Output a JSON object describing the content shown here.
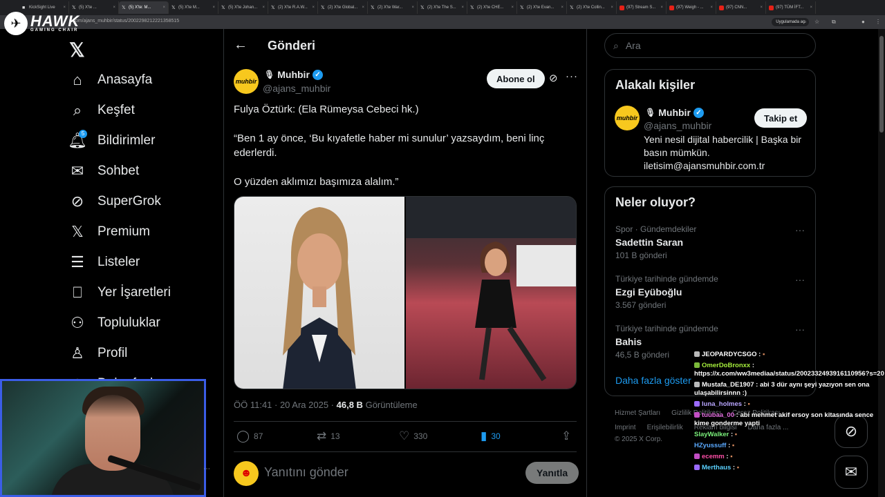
{
  "browser": {
    "tabs": [
      {
        "label": "KickSight Live",
        "icon": "k"
      },
      {
        "label": "(5) X'te ...",
        "icon": "x"
      },
      {
        "label": "(5) X'te: M...",
        "icon": "x",
        "active": true
      },
      {
        "label": "(5) X'te M...",
        "icon": "x"
      },
      {
        "label": "(5) X'te Johan...",
        "icon": "x"
      },
      {
        "label": "(2) X'te R.A.W...",
        "icon": "x"
      },
      {
        "label": "(2) X'te Global...",
        "icon": "x"
      },
      {
        "label": "(2) X'te War...",
        "icon": "x"
      },
      {
        "label": "(2) X'te The S...",
        "icon": "x"
      },
      {
        "label": "(2) X'te CHE...",
        "icon": "x"
      },
      {
        "label": "(2) X'te Evan...",
        "icon": "x"
      },
      {
        "label": "(2) X'te Collin...",
        "icon": "x"
      },
      {
        "label": "(97) Stream S...",
        "icon": "yt"
      },
      {
        "label": "(97) Weigh - ...",
        "icon": "yt"
      },
      {
        "label": "(97) CNN...",
        "icon": "yt"
      },
      {
        "label": "(97) TÜM İFT...",
        "icon": "yt"
      }
    ],
    "url": "x.com/ajans_muhbir/status/2002298212221358515",
    "open_in_app": "Uygulamada aç"
  },
  "overlay_logo": {
    "name": "HAWK",
    "sub": "GAMING CHAIR"
  },
  "nav": {
    "items": [
      {
        "key": "home",
        "label": "Anasayfa",
        "icon": "home-icon"
      },
      {
        "key": "explore",
        "label": "Keşfet",
        "icon": "search-icon"
      },
      {
        "key": "notifications",
        "label": "Bildirimler",
        "icon": "bell-icon",
        "badge": "5"
      },
      {
        "key": "chat",
        "label": "Sohbet",
        "icon": "mail-icon"
      },
      {
        "key": "supergrok",
        "label": "SuperGrok",
        "icon": "grok-icon"
      },
      {
        "key": "premium",
        "label": "Premium",
        "icon": "x-logo-icon"
      },
      {
        "key": "lists",
        "label": "Listeler",
        "icon": "list-icon"
      },
      {
        "key": "bookmarks",
        "label": "Yer İşaretleri",
        "icon": "bookmark-icon"
      },
      {
        "key": "communities",
        "label": "Topluluklar",
        "icon": "people-icon"
      },
      {
        "key": "profile",
        "label": "Profil",
        "icon": "person-icon"
      },
      {
        "key": "more",
        "label": "Daha fazla",
        "icon": "more-circle-icon"
      }
    ]
  },
  "post": {
    "header_title": "Gönderi",
    "author_name": "Muhbir",
    "author_handle": "@ajans_muhbir",
    "avatar_text": "muhbir",
    "subscribe_label": "Abone ol",
    "text_lines": [
      "Fulya Öztürk: (Ela Rümeysa Cebeci hk.)",
      "“Ben 1 ay önce, ‘Bu kıyafetle haber mi sunulur’ yazsaydım, beni linç ederlerdi.",
      "O yüzden aklımızı başımıza alalım.”"
    ],
    "timestamp": "ÖÖ 11:41 · 20 Ara 2025 ·",
    "views": "46,8 B",
    "views_label": "Görüntüleme",
    "replies": "87",
    "reposts": "13",
    "likes": "330",
    "bookmarks": "30",
    "reply_placeholder": "Yanıtını gönder",
    "reply_button": "Yanıtla"
  },
  "search": {
    "placeholder": "Ara"
  },
  "related": {
    "title": "Alakalı kişiler",
    "name": "Muhbir",
    "handle": "@ajans_muhbir",
    "follow_label": "Takip et",
    "bio": "Yeni nesil dijital habercilik | Başka bir basın mümkün. iletisim@ajansmuhbir.com.tr"
  },
  "trends": {
    "title": "Neler oluyor?",
    "items": [
      {
        "category": "Spor · Gündemdekiler",
        "name": "Sadettin Saran",
        "count": "101 B gönderi"
      },
      {
        "category": "Türkiye tarihinde gündemde",
        "name": "Ezgi Eyüboğlu",
        "count": "3.567 gönderi"
      },
      {
        "category": "Türkiye tarihinde gündemde",
        "name": "Bahis",
        "count": "46,5 B gönderi"
      }
    ],
    "show_more": "Daha fazla göster"
  },
  "footer": {
    "row1": [
      "Hizmet Şartları",
      "Gizlilik Politikası",
      "Çerez Politikası"
    ],
    "row2": [
      "Imprint",
      "Erişilebilirlik",
      "Reklam bilgisi",
      "Daha fazla ..."
    ],
    "copyright": "© 2025 X Corp."
  },
  "chat": {
    "messages": [
      {
        "user": "JEOPARDYCSGO",
        "text": "",
        "color": "#ffffff",
        "dot": "#b8b8b8"
      },
      {
        "user": "OmerDoBronxx",
        "text": "https://x.com/ww3mediaa/status/2002332493916110956?s=20",
        "color": "#a7f03c",
        "dot": "#7bb93a"
      },
      {
        "user": "Mustafa_DE1907",
        "text": "abi 3 dür aynı şeyi yazıyon sen ona ulaşabilirsinnn :)",
        "color": "#ffffff",
        "dot": "#b8b8b8"
      },
      {
        "user": "luna_holmes",
        "text": "",
        "color": "#b9a6ff",
        "dot": "#9b6bff"
      },
      {
        "user": "tuubaa_00",
        "text": "abi mehmet akif ersoy son kitasında sence kime gonderme yapti",
        "color": "#e46ee0",
        "dot": "#c24ec4"
      },
      {
        "user": "SlayWalker",
        "text": "",
        "color": "#7bf07b",
        "dot": ""
      },
      {
        "user": "HZyussuff",
        "text": "",
        "color": "#5aa9ff",
        "dot": ""
      },
      {
        "user": "ecemm",
        "text": "",
        "color": "#ff4fa8",
        "dot": "#c24ec4"
      },
      {
        "user": "Merthaus",
        "text": "",
        "color": "#5ad1ff",
        "dot": "#9b6bff"
      }
    ]
  },
  "colors": {
    "accent": "#1d9bf0",
    "bg": "#000000",
    "border": "#2f3336",
    "muted": "#71767b"
  }
}
